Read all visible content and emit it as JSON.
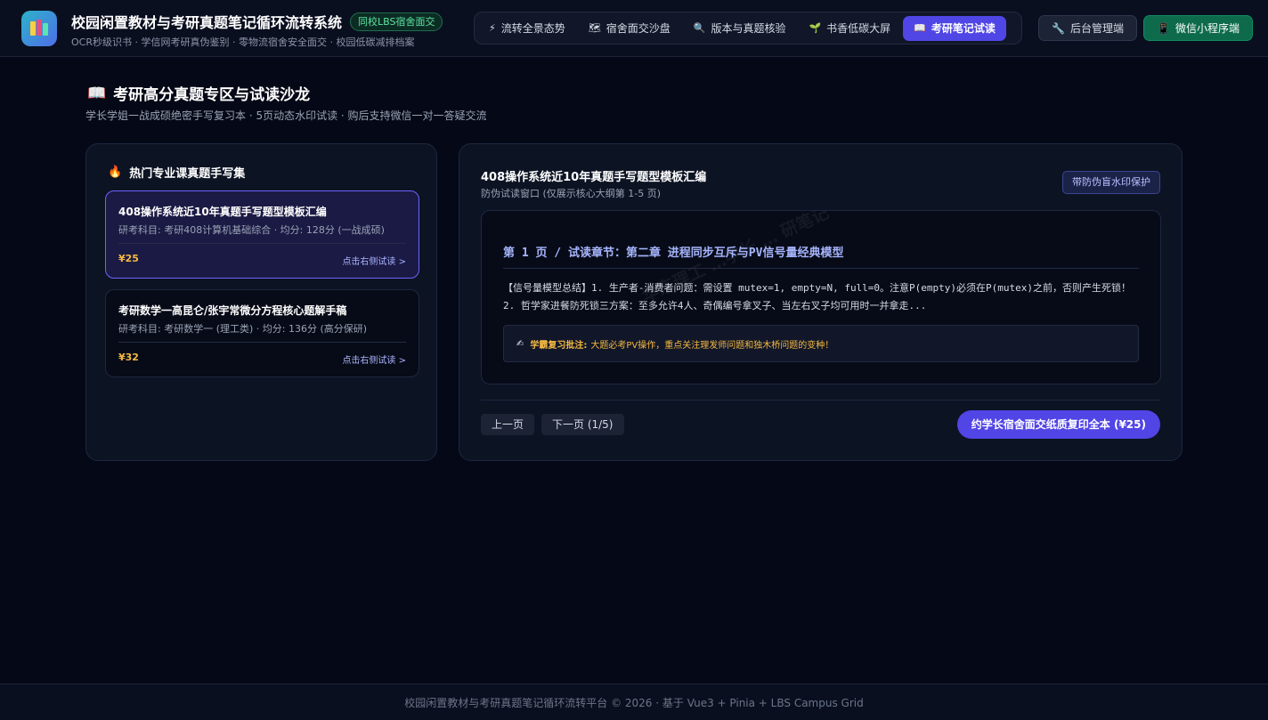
{
  "header": {
    "title": "校园闲置教材与考研真题笔记循环流转系统",
    "badge": "同校LBS宿舍面交",
    "subtitle": "OCR秒级识书 · 学信网考研真伪鉴别 · 零物流宿舍安全面交 · 校园低碳减排档案",
    "nav": [
      {
        "label": "流转全景态势",
        "icon": "lightning-icon"
      },
      {
        "label": "宿舍面交沙盘",
        "icon": "map-icon"
      },
      {
        "label": "版本与真题核验",
        "icon": "magnifier-icon"
      },
      {
        "label": "书香低碳大屏",
        "icon": "sprout-icon"
      },
      {
        "label": "考研笔记试读",
        "icon": "book-icon"
      }
    ],
    "active_nav": "考研笔记试读",
    "admin_label": "后台管理端",
    "wechat_label": "微信小程序端"
  },
  "section": {
    "title": "考研高分真题专区与试读沙龙",
    "subtitle": "学长学姐一战成硕绝密手写复习本 · 5页动态水印试读 · 购后支持微信一对一答疑交流"
  },
  "left_panel": {
    "title": "热门专业课真题手写集",
    "cards": [
      {
        "name": "408操作系统近10年真题手写题型模板汇编",
        "meta": "研考科目: 考研408计算机基础综合 · 均分: 128分 (一战成硕)",
        "price": "¥25",
        "link": "点击右侧试读 >"
      },
      {
        "name": "考研数学一高昆仑/张宇常微分方程核心题解手稿",
        "meta": "研考科目: 考研数学一 (理工类) · 均分: 136分 (高分保研)",
        "price": "¥32",
        "link": "点击右侧试读 >"
      }
    ]
  },
  "reader": {
    "title": "408操作系统近10年真题手写题型模板汇编",
    "subtitle": "防伪试读窗口 (仅展示核心大纲第 1-5 页)",
    "watermark_badge": "带防伪盲水印保护",
    "watermark_text": "华东理工 …学长 … 研笔记 · 严禁翻印",
    "chapter": "第 1 页 / 试读章节：第二章 进程同步互斥与PV信号量经典模型",
    "body": "【信号量模型总结】1. 生产者-消费者问题：需设置 mutex=1, empty=N, full=0。注意P(empty)必须在P(mutex)之前，否则产生死锁！2. 哲学家进餐防死锁三方案：至多允许4人、奇偶编号拿叉子、当左右叉子均可用时一并拿走...",
    "note_label": "学霸复习批注:",
    "note_text": "大题必考PV操作，重点关注理发师问题和独木桥问题的变种！",
    "prev_label": "上一页",
    "next_label": "下一页 (1/5)",
    "buy_label": "约学长宿舍面交纸质复印全本 (¥25)"
  },
  "footer": {
    "text": "校园闲置教材与考研真题笔记循环流转平台 © 2026 · 基于 Vue3 + Pinia + LBS Campus Grid"
  },
  "colors": {
    "accent": "#4f46e5",
    "price": "#f5b942",
    "success": "#5ee3a3",
    "background": "#050816"
  }
}
